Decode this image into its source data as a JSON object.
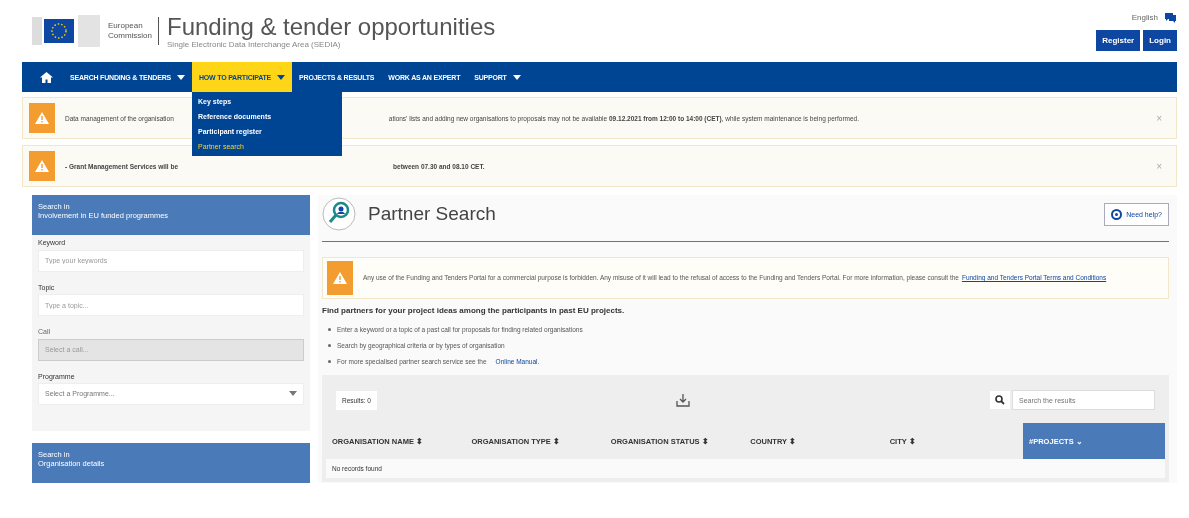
{
  "header": {
    "org_line1": "European",
    "org_line2": "Commission",
    "title": "Funding & tender opportunities",
    "subtitle": "Single Electronic Data Interchange Area (SEDIA)",
    "language": "English",
    "buttons": [
      "Register",
      "Login"
    ]
  },
  "nav": {
    "items": [
      {
        "label": "SEARCH FUNDING & TENDERS",
        "dropdown": true,
        "selected": false
      },
      {
        "label": "HOW TO PARTICIPATE",
        "dropdown": true,
        "selected": true
      },
      {
        "label": "PROJECTS & RESULTS",
        "dropdown": false,
        "selected": false
      },
      {
        "label": "WORK AS AN EXPERT",
        "dropdown": false,
        "selected": false
      },
      {
        "label": "SUPPORT",
        "dropdown": true,
        "selected": false
      }
    ],
    "menu": [
      {
        "label": "Key steps",
        "selected": false
      },
      {
        "label": "Reference documents",
        "selected": false
      },
      {
        "label": "Participant register",
        "selected": false
      },
      {
        "label": "Partner search",
        "selected": true
      }
    ]
  },
  "alerts": [
    {
      "text_start": "Data management of the organisation",
      "text_end": "ations' lists and adding new organisations to proposals may not be available **09.12.2021 from 12:00 to 14:00 (CET)**, while system maintenance is being performed.",
      "bold": false,
      "close": "×"
    },
    {
      "text_start": "- Grant Management Services will be",
      "text_end": "between 07.30 and 08.10 CET.",
      "bold": true,
      "close": "×"
    }
  ],
  "sidebar": {
    "sections": [
      {
        "eyebrow": "Search in",
        "title": "Involvement in EU funded programmes",
        "fields": [
          {
            "label": "Keyword",
            "placeholder": "Type your keywords",
            "kind": "text",
            "disabled": false
          },
          {
            "label": "Topic",
            "placeholder": "Type a topic...",
            "kind": "text",
            "disabled": false
          },
          {
            "label": "Call",
            "placeholder": "Select a call...",
            "kind": "text",
            "disabled": true
          },
          {
            "label": "Programme",
            "placeholder": "Select a Programme...",
            "kind": "select",
            "disabled": false
          }
        ]
      },
      {
        "eyebrow": "Search in",
        "title": "Organisation details"
      }
    ]
  },
  "main": {
    "title": "Partner Search",
    "help_button": "Need help?",
    "notice": {
      "text": "Any use of the Funding and Tenders Portal for a commercial purpose is forbidden. Any misuse of it will lead to the refusal of access to the Funding and Tenders Portal. For more information, please consult the",
      "link": "Funding and Tenders Portal Terms and Conditions"
    },
    "intro": "Find partners for your project ideas among the participants in past EU projects.",
    "bullets": [
      {
        "text": "Enter a keyword or a topic of a past call for proposals for finding related organisations"
      },
      {
        "text": "Search by geographical criteria or by types of organisation"
      },
      {
        "text": "For more specialised partner search service see the",
        "link": "Online Manual."
      }
    ],
    "results": {
      "label": "Results: 0",
      "search_placeholder": "Search the results",
      "columns": [
        {
          "label": "ORGANISATION NAME",
          "sort": "⬍",
          "selected": false
        },
        {
          "label": "ORGANISATION TYPE",
          "sort": "⬍",
          "selected": false
        },
        {
          "label": "ORGANISATION STATUS",
          "sort": "⬍",
          "selected": false
        },
        {
          "label": "COUNTRY",
          "sort": "⬍",
          "selected": false
        },
        {
          "label": "CITY",
          "sort": "⬍",
          "selected": false
        },
        {
          "label": "#PROJECTS",
          "sort": "⌄",
          "selected": true
        }
      ],
      "empty": "No records found"
    }
  }
}
